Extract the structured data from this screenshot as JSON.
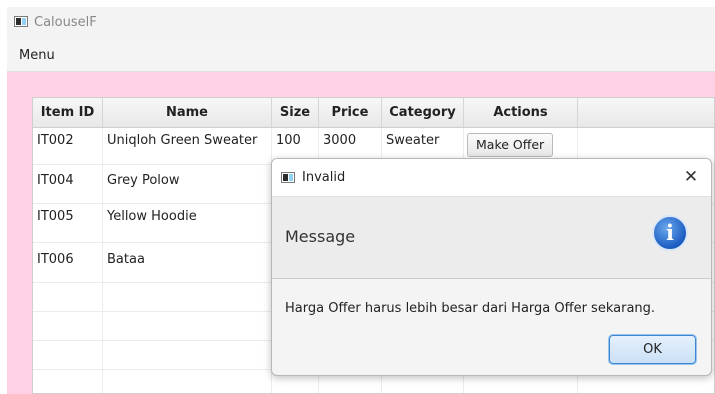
{
  "window": {
    "title": "CalouselF"
  },
  "menubar": {
    "items": [
      {
        "label": "Menu"
      }
    ]
  },
  "table": {
    "columns": [
      "Item ID",
      "Name",
      "Size",
      "Price",
      "Category",
      "Actions"
    ],
    "rows": [
      {
        "id": "IT002",
        "name": "Uniqloh Green Sweater",
        "size": "100",
        "price": "3000",
        "category": "Sweater",
        "action": "Make Offer"
      },
      {
        "id": "IT004",
        "name": "Grey Polow",
        "size": "",
        "price": "",
        "category": "",
        "action": ""
      },
      {
        "id": "IT005",
        "name": "Yellow Hoodie",
        "size": "",
        "price": "",
        "category": "",
        "action": ""
      },
      {
        "id": "IT006",
        "name": "Bataa",
        "size": "",
        "price": "",
        "category": "",
        "action": ""
      }
    ]
  },
  "dialog": {
    "title": "Invalid",
    "close_glyph": "✕",
    "header": "Message",
    "icon_glyph": "i",
    "content": "Harga Offer harus lebih besar dari Harga Offer sekarang.",
    "ok_label": "OK",
    "icon": "info-icon"
  },
  "colors": {
    "background": "#ffd1e4",
    "accent": "#3a86d2",
    "info": "#1b5cc2"
  }
}
